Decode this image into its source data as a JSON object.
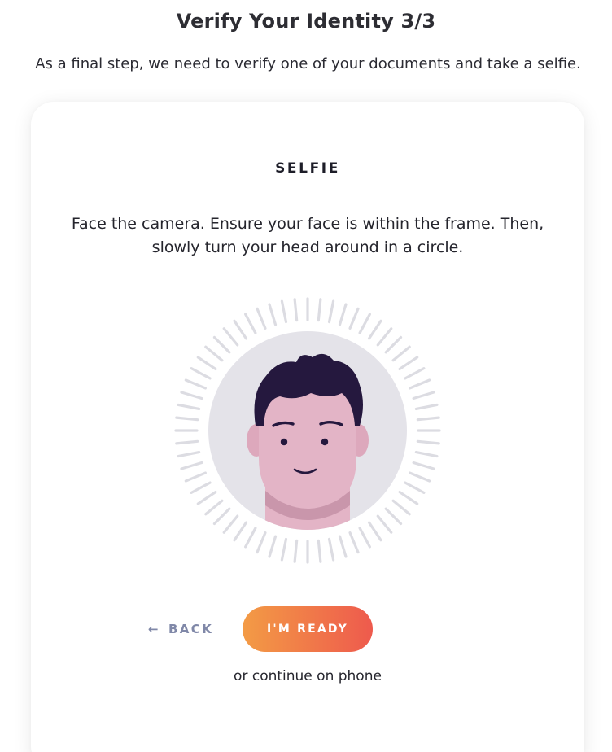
{
  "header": {
    "title": "Verify Your Identity 3/3",
    "subtitle": "As a final step, we need to verify one of your documents and take a selfie."
  },
  "card": {
    "heading": "SELFIE",
    "instructions": "Face the camera. Ensure your face is within the frame. Then, slowly turn your head around in a circle."
  },
  "face_illustration": {
    "icon": "person-face-icon",
    "colors": {
      "ring_ticks": "#dcdce2",
      "background_circle": "#e4e3e9",
      "skin": "#e3b4c6",
      "skin_shadow": "#c996ab",
      "hair": "#25183e"
    }
  },
  "actions": {
    "back_icon": "arrow-left-icon",
    "back_label": "BACK",
    "ready_label": "I'M READY",
    "phone_link": "or continue on phone"
  },
  "colors": {
    "accent_gradient_start": "#f39b45",
    "accent_gradient_end": "#ee5a4d",
    "back_text": "#8088a8"
  }
}
